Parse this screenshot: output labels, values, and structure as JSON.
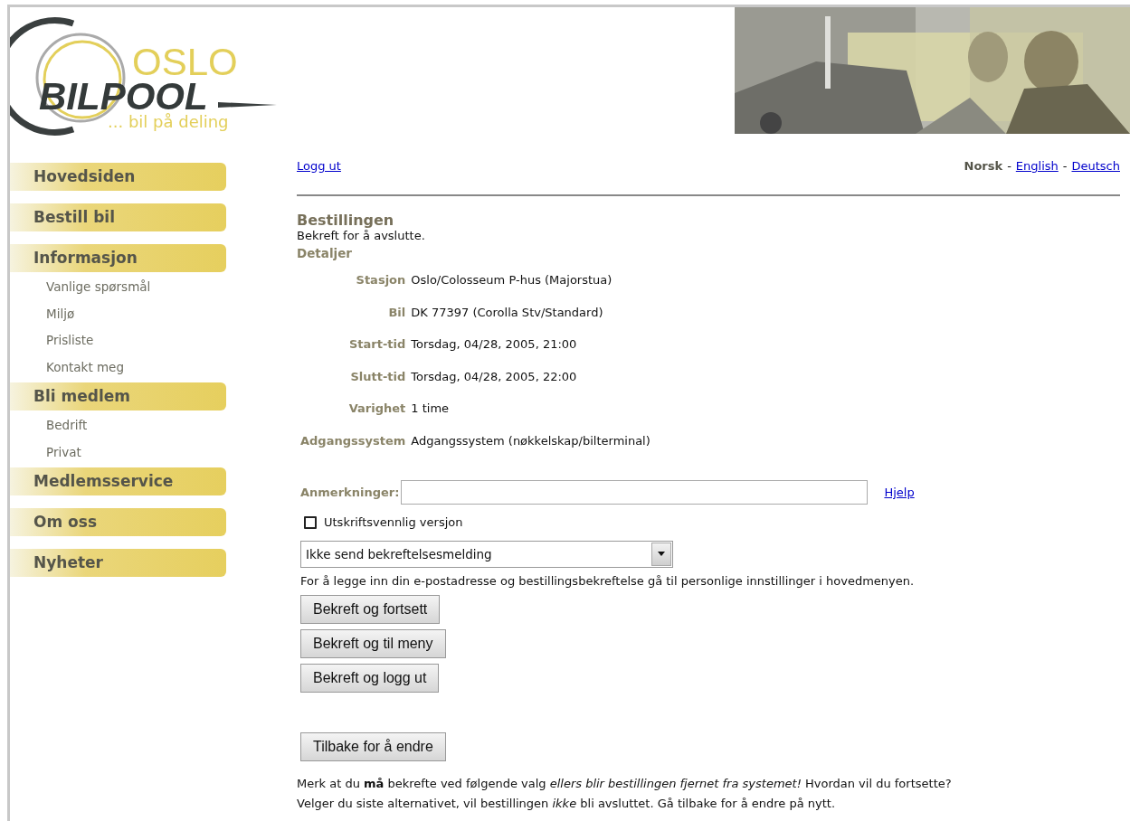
{
  "logo": {
    "top": "OSLO",
    "main": "BILPOOL",
    "tagline": "... bil på deling"
  },
  "banner": {
    "kind": "picture"
  },
  "sidebar": {
    "items": [
      {
        "label": "Hovedsiden",
        "kind": "main"
      },
      {
        "label": "Bestill bil",
        "kind": "main"
      },
      {
        "label": "Informasjon",
        "kind": "main"
      },
      {
        "label": "Vanlige spørsmål",
        "kind": "sub"
      },
      {
        "label": "Miljø",
        "kind": "sub"
      },
      {
        "label": "Prisliste",
        "kind": "sub"
      },
      {
        "label": "Kontakt meg",
        "kind": "sub"
      },
      {
        "label": "Bli medlem",
        "kind": "main"
      },
      {
        "label": "Bedrift",
        "kind": "sub"
      },
      {
        "label": "Privat",
        "kind": "sub"
      },
      {
        "label": "Medlemsservice",
        "kind": "main"
      },
      {
        "label": "Om oss",
        "kind": "main"
      },
      {
        "label": "Nyheter",
        "kind": "main"
      }
    ]
  },
  "logout": "Logg ut",
  "languages": [
    {
      "label": "Norsk",
      "selected": true
    },
    {
      "label": "English",
      "selected": false
    },
    {
      "label": "Deutsch",
      "selected": false
    }
  ],
  "language_separator": "-",
  "title": "Bestillingen",
  "subtitle": "Bekreft for å avslutte.",
  "details_heading": "Detaljer",
  "details": [
    {
      "label": "Stasjon",
      "value": "Oslo/Colosseum P-hus (Majorstua)"
    },
    {
      "label": "Bil",
      "value": "DK 77397 (Corolla Stv/Standard)"
    },
    {
      "label": "Start-tid",
      "value": "Torsdag, 04/28, 2005, 21:00"
    },
    {
      "label": "Slutt-tid",
      "value": "Torsdag, 04/28, 2005, 22:00"
    },
    {
      "label": "Varighet",
      "value": "1 time"
    },
    {
      "label": "Adgangssystem",
      "value": "Adgangssystem (nøkkelskap/bilterminal)"
    }
  ],
  "remarks": {
    "label": "Anmerkninger:",
    "help": "Hjelp"
  },
  "print_version": {
    "label": "Utskriftsvennlig versjon",
    "checked": false
  },
  "confirmation_select": {
    "value": "Ikke send bekreftelsesmelding"
  },
  "info": "For å legge inn din e-postadresse og bestillingsbekreftelse gå til personlige innstillinger i hovedmenyen.",
  "confirm_buttons": [
    "Bekreft og fortsett",
    "Bekreft og til meny",
    "Bekreft og logg ut"
  ],
  "back_button": "Tilbake for å endre",
  "note": [
    "Merk at du **må** bekrefte ved følgende valg *ellers blir bestillingen fjernet fra systemet!* Hvordan vil du fortsette?",
    "Velger du siste alternativet, vil bestillingen *ikke* bli avsluttet. Gå tilbake for å endre på nytt."
  ]
}
